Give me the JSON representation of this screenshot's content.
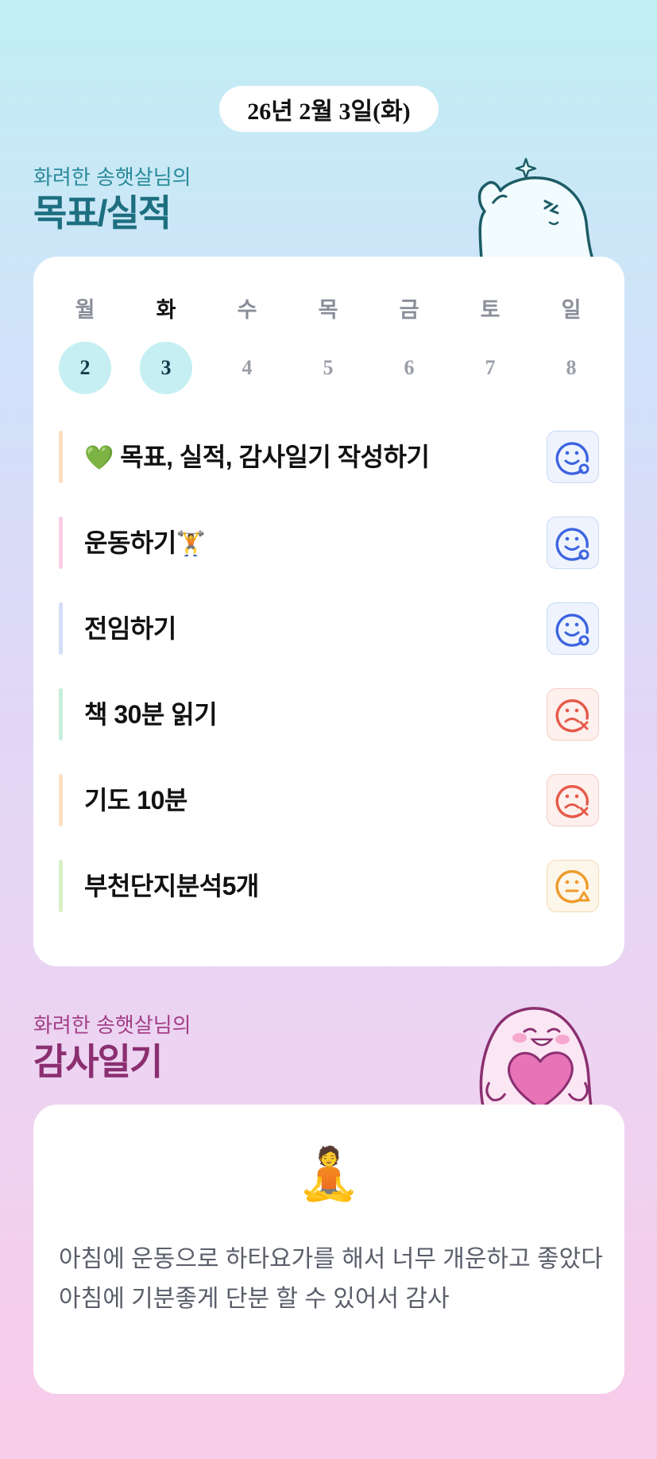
{
  "date": "26년 2월 3일(화)",
  "goals_section": {
    "subtitle": "화려한 송햇살님의",
    "title": "목표/실적"
  },
  "week": {
    "days": [
      "월",
      "화",
      "수",
      "목",
      "금",
      "토",
      "일"
    ],
    "dates": [
      "2",
      "3",
      "4",
      "5",
      "6",
      "7",
      "8"
    ],
    "active_day": "화"
  },
  "goals": [
    {
      "emoji": "💚",
      "label": "목표, 실적, 감사일기 작성하기",
      "bar_color": "#fcdfc0",
      "status": "good"
    },
    {
      "emoji": "",
      "label": "운동하기",
      "emoji_after": "🏋",
      "bar_color": "#f9cde6",
      "status": "good"
    },
    {
      "emoji": "",
      "label": "전임하기",
      "bar_color": "#d4ddf6",
      "status": "good"
    },
    {
      "emoji": "",
      "label": "책 30분 읽기",
      "bar_color": "#c6eedd",
      "status": "bad"
    },
    {
      "emoji": "",
      "label": "기도 10분",
      "bar_color": "#fde0c2",
      "status": "bad"
    },
    {
      "emoji": "",
      "label": "부천단지분석5개",
      "bar_color": "#d8f0c6",
      "status": "mid"
    }
  ],
  "status_icons": {
    "good": {
      "name": "smile-circle-icon",
      "color": "#3d63e0"
    },
    "bad": {
      "name": "sad-x-icon",
      "color": "#e65a4a"
    },
    "mid": {
      "name": "neutral-triangle-icon",
      "color": "#ed9a2b"
    }
  },
  "gratitude_section": {
    "subtitle": "화려한 송햇살님의",
    "title": "감사일기"
  },
  "gratitude": {
    "emoji": "🧘",
    "text": "아침에 운동으로 하타요가를 해서 너무 개운하고 좋았다\n아침에 기분좋게 단분 할 수 있어서 감사"
  }
}
